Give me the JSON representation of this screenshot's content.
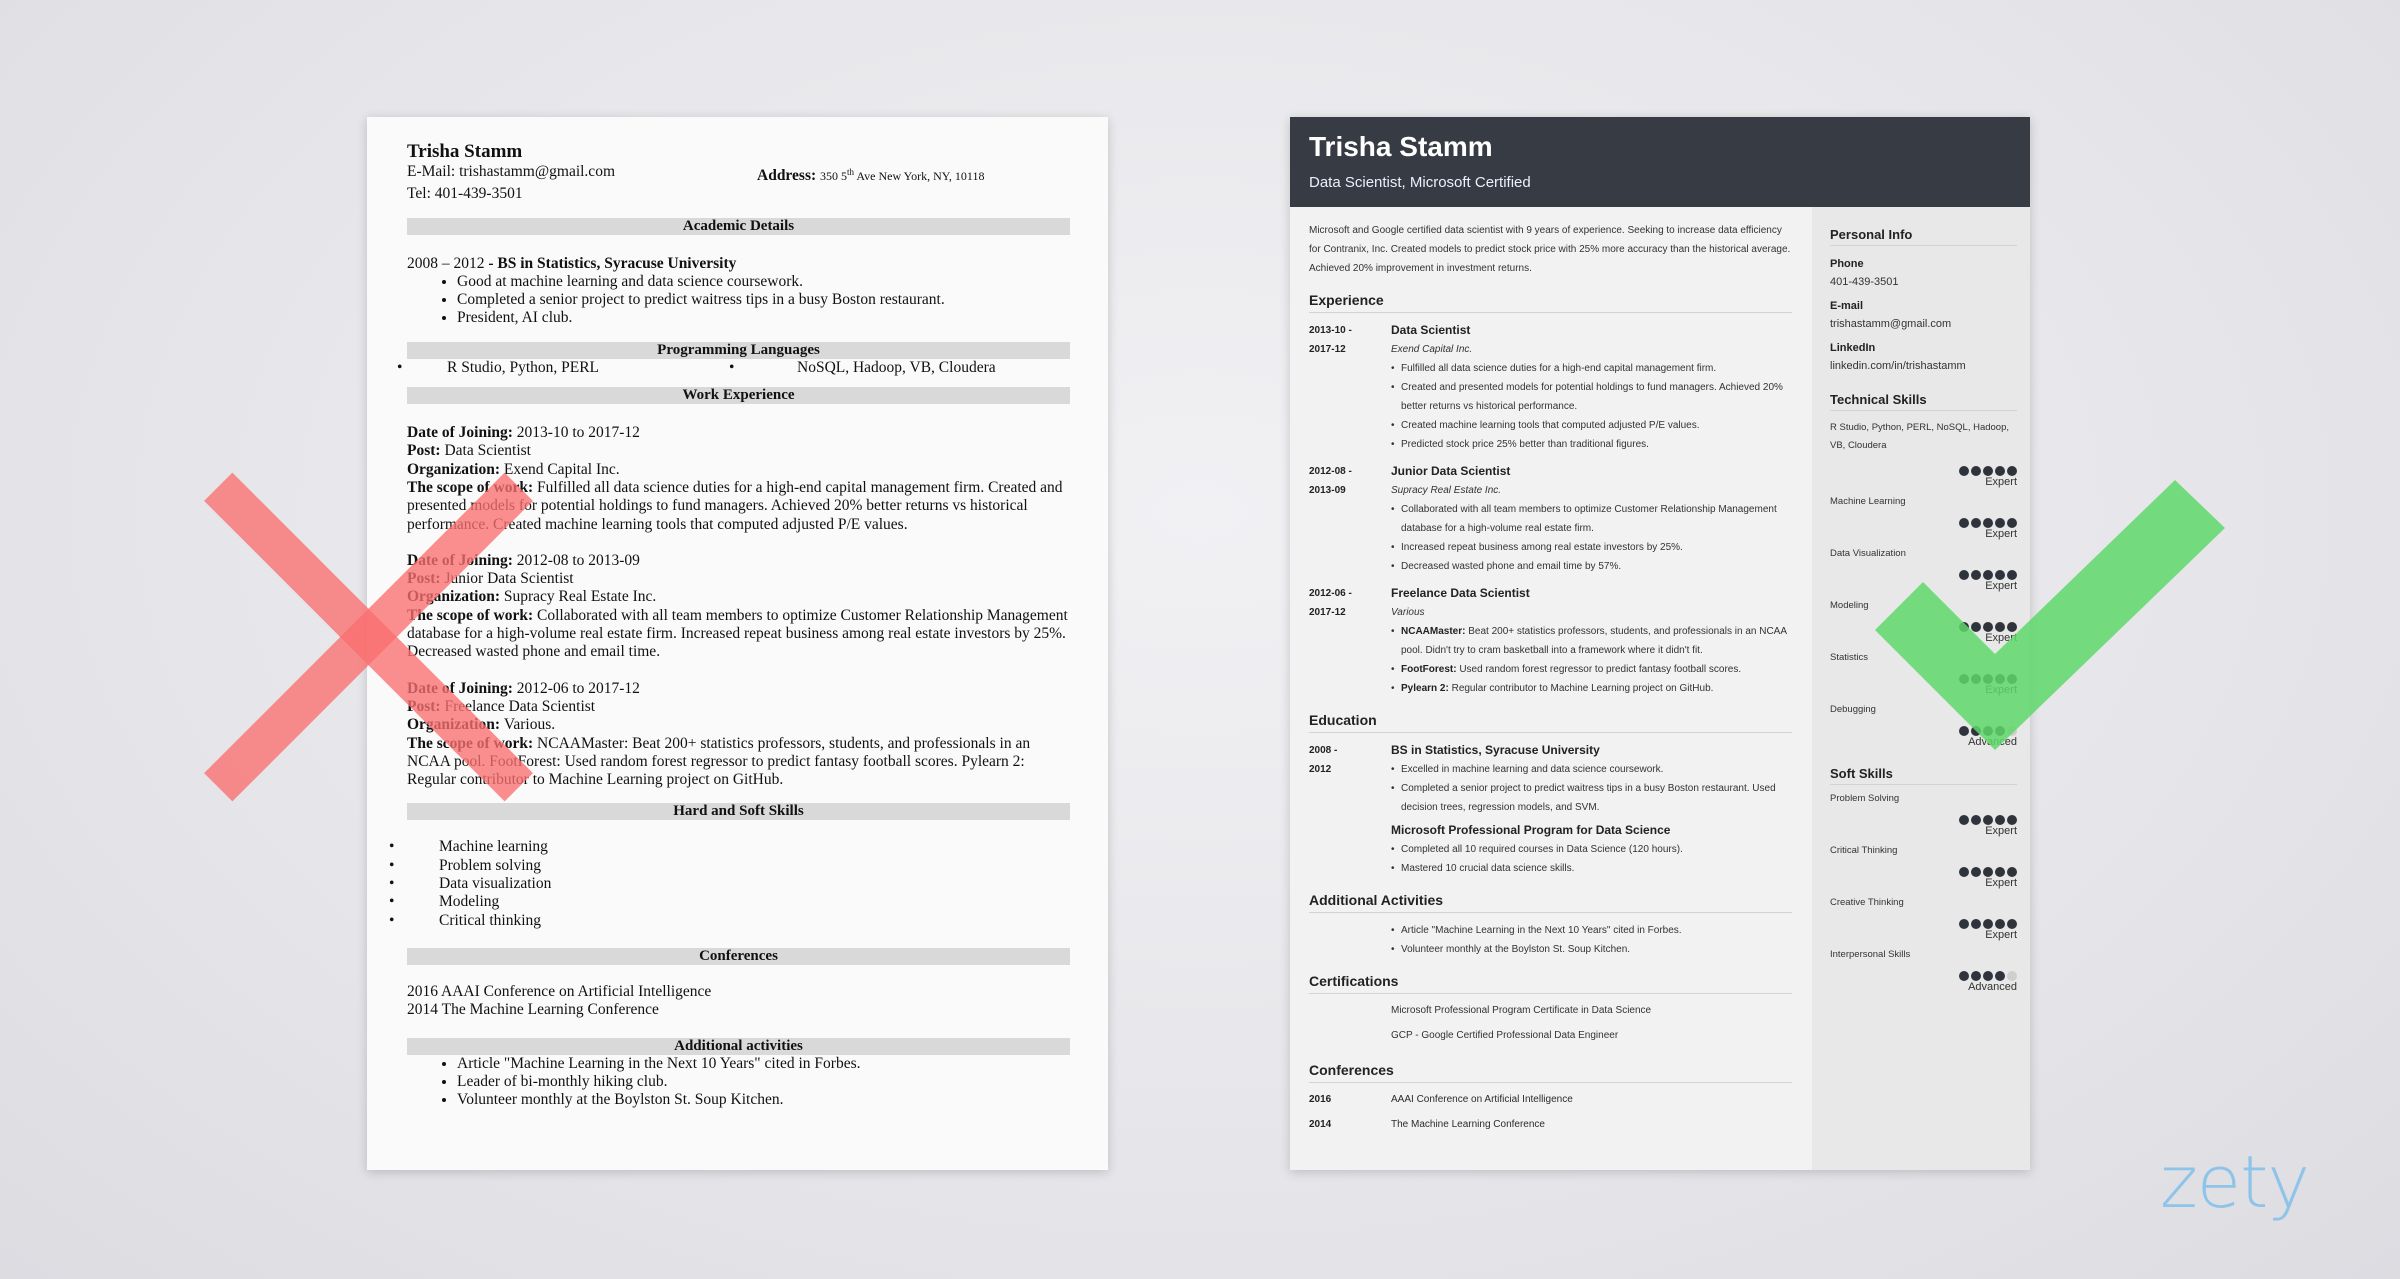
{
  "bad_resume": {
    "name": "Trisha Stamm",
    "email_label": "E-Mail: ",
    "email": "trishastamm@gmail.com",
    "tel_label": "Tel: ",
    "tel": "401-439-3501",
    "address_label": "Address: ",
    "address_pre": "350 5",
    "address_sup": "th",
    "address_post": " Ave New York, NY, 10118",
    "sections": {
      "academic": "Academic Details",
      "programming": "Programming Languages",
      "work": "Work Experience",
      "skills": "Hard and Soft Skills",
      "conferences": "Conferences",
      "activities": "Additional activities"
    },
    "academic": {
      "years": "2008 – 2012 ",
      "degree": "- BS in Statistics, Syracuse University",
      "bullets": [
        "Good at machine learning and data science coursework.",
        "Completed a senior project to predict waitress tips in a busy Boston restaurant.",
        "President, AI club."
      ]
    },
    "programming": [
      "R Studio, Python, PERL",
      "NoSQL, Hadoop, VB, Cloudera"
    ],
    "labels": {
      "date": "Date of Joining: ",
      "post": "Post: ",
      "org": "Organization: ",
      "scope": "The scope of work: "
    },
    "jobs": [
      {
        "date": "2013-10 to 2017-12",
        "post": "Data Scientist",
        "org": "Exend Capital Inc.",
        "scope": "Fulfilled all data science duties for a high-end capital management firm. Created and presented models for potential holdings to fund managers. Achieved 20% better returns vs historical performance. Created machine learning tools that computed adjusted P/E values."
      },
      {
        "date": "2012-08 to 2013-09",
        "post": "Junior Data Scientist",
        "org": "Supracy Real Estate Inc.",
        "scope": "Collaborated with all team members to optimize Customer Relationship Management database for a high-volume real estate firm. Increased repeat business among real estate investors by 25%. Decreased wasted phone and email time."
      },
      {
        "date": "2012-06 to 2017-12",
        "post": "Freelance Data Scientist",
        "org": "Various.",
        "scope": "NCAAMaster: Beat 200+ statistics professors, students, and professionals in an NCAA pool. FootForest: Used random forest regressor to predict fantasy football scores. Pylearn 2: Regular contributor to Machine Learning project on GitHub."
      }
    ],
    "skills": [
      "Machine learning",
      "Problem solving",
      "Data visualization",
      "Modeling",
      "Critical thinking"
    ],
    "conferences": [
      "2016 AAAI Conference on Artificial Intelligence",
      "2014 The Machine Learning Conference"
    ],
    "activities": [
      "Article \"Machine Learning in the Next 10 Years\" cited in Forbes.",
      "Leader of bi-monthly hiking club.",
      "Volunteer monthly at the Boylston St. Soup Kitchen."
    ]
  },
  "good_resume": {
    "name": "Trisha Stamm",
    "title": "Data Scientist, Microsoft Certified",
    "summary": "Microsoft and Google certified data scientist with 9 years of experience. Seeking to increase data efficiency for Contranix, Inc. Created models to predict stock price with 25% more accuracy than the historical average. Achieved 20% improvement in investment returns.",
    "sections": {
      "experience": "Experience",
      "education": "Education",
      "activities": "Additional Activities",
      "certifications": "Certifications",
      "conferences": "Conferences"
    },
    "experience": [
      {
        "date_start": "2013-10 -",
        "date_end": "2017-12",
        "role": "Data Scientist",
        "org": "Exend Capital Inc.",
        "bullets": [
          {
            "bold": "",
            "text": "Fulfilled all data science duties for a high-end capital management firm."
          },
          {
            "bold": "",
            "text": "Created and presented models for potential holdings to fund managers. Achieved 20% better returns vs historical performance."
          },
          {
            "bold": "",
            "text": "Created machine learning tools that computed adjusted P/E values."
          },
          {
            "bold": "",
            "text": "Predicted stock price 25% better than traditional figures."
          }
        ]
      },
      {
        "date_start": "2012-08 -",
        "date_end": "2013-09",
        "role": "Junior Data Scientist",
        "org": "Supracy Real Estate Inc.",
        "bullets": [
          {
            "bold": "",
            "text": "Collaborated with all team members to optimize Customer Relationship Management database for a high-volume real estate firm."
          },
          {
            "bold": "",
            "text": "Increased repeat business among real estate investors by 25%."
          },
          {
            "bold": "",
            "text": "Decreased wasted phone and email time by 57%."
          }
        ]
      },
      {
        "date_start": "2012-06 -",
        "date_end": "2017-12",
        "role": "Freelance Data Scientist",
        "org": "Various",
        "bullets": [
          {
            "bold": "NCAAMaster:",
            "text": " Beat 200+ statistics professors, students, and professionals in an NCAA pool. Didn't try to cram basketball into a framework where it didn't fit."
          },
          {
            "bold": "FootForest:",
            "text": " Used random forest regressor to predict fantasy football scores."
          },
          {
            "bold": "Pylearn 2:",
            "text": " Regular contributor to Machine Learning project on GitHub."
          }
        ]
      }
    ],
    "education": {
      "date_start": "2008 -",
      "date_end": "2012",
      "degree": "BS in Statistics, Syracuse University",
      "degree_bullets": [
        "Excelled in machine learning and data science coursework.",
        "Completed a senior project to predict waitress tips in a busy Boston restaurant. Used decision trees, regression models, and SVM."
      ],
      "program": "Microsoft Professional Program for Data Science",
      "program_bullets": [
        "Completed all 10 required courses in Data Science (120 hours).",
        "Mastered 10 crucial data science skills."
      ]
    },
    "activities": [
      "Article \"Machine Learning in the Next 10 Years\" cited in Forbes.",
      "Volunteer monthly at the Boylston St. Soup Kitchen."
    ],
    "certifications": [
      "Microsoft Professional Program Certificate in Data Science",
      "GCP - Google Certified Professional Data Engineer"
    ],
    "conferences": [
      {
        "year": "2016",
        "name": "AAAI Conference on Artificial Intelligence"
      },
      {
        "year": "2014",
        "name": "The Machine Learning Conference"
      }
    ],
    "sidebar": {
      "personal_info": "Personal Info",
      "phone_label": "Phone",
      "phone": "401-439-3501",
      "email_label": "E-mail",
      "email": "trishastamm@gmail.com",
      "linkedin_label": "LinkedIn",
      "linkedin": "linkedin.com/in/trishastamm",
      "technical_skills": "Technical Skills",
      "soft_skills": "Soft Skills",
      "tech": [
        {
          "name": "R Studio, Python, PERL, NoSQL, Hadoop, VB, Cloudera",
          "rating": 5,
          "level": "Expert"
        },
        {
          "name": "Machine Learning",
          "rating": 5,
          "level": "Expert"
        },
        {
          "name": "Data Visualization",
          "rating": 5,
          "level": "Expert"
        },
        {
          "name": "Modeling",
          "rating": 5,
          "level": "Expert"
        },
        {
          "name": "Statistics",
          "rating": 5,
          "level": "Expert"
        },
        {
          "name": "Debugging",
          "rating": 4,
          "level": "Advanced"
        }
      ],
      "soft": [
        {
          "name": "Problem Solving",
          "rating": 5,
          "level": "Expert"
        },
        {
          "name": "Critical Thinking",
          "rating": 5,
          "level": "Expert"
        },
        {
          "name": "Creative Thinking",
          "rating": 5,
          "level": "Expert"
        },
        {
          "name": "Interpersonal Skills",
          "rating": 4,
          "level": "Advanced"
        }
      ],
      "rating_max": 5
    }
  },
  "colors": {
    "x_mark": "#f87171",
    "check_mark": "#5ed86a",
    "header_bg": "#363b44",
    "logo": "#8fc4ea"
  },
  "logo": "zety"
}
